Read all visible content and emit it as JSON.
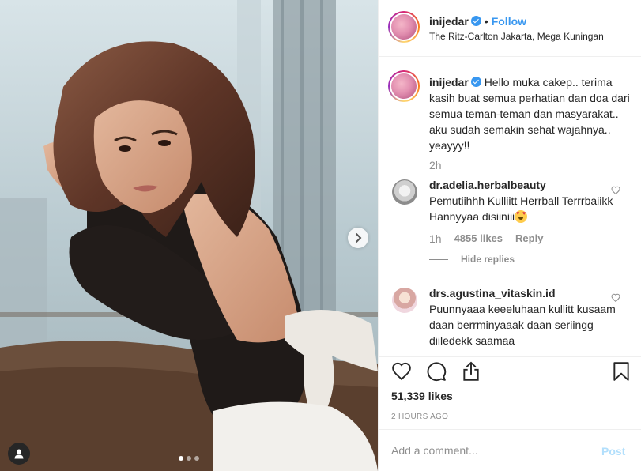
{
  "header": {
    "username": "inijedar",
    "separator": "•",
    "follow_label": "Follow",
    "location": "The Ritz-Carlton Jakarta, Mega Kuningan"
  },
  "caption": {
    "username": "inijedar",
    "text": "Hello muka cakep.. terima kasih buat semua perhatian dan doa dari semua teman-teman dan masyarakat.. aku sudah semakin sehat wajahnya.. yeayyy!!",
    "time": "2h"
  },
  "comments": [
    {
      "username": "dr.adelia.herbalbeauty",
      "text": "Pemutiihhh Kulliitt Herrball Terrrbaiikk Hannyyaa disiiniii",
      "age": "1h",
      "likes": "4855 likes",
      "reply_label": "Reply",
      "hide_replies_label": "Hide replies"
    },
    {
      "username": "drs.agustina_vitaskin.id",
      "text": "Puunnyaaa keeeluhaan kullitt kusaam daan berrminyaaak daan seriingg diiledekk saamaa"
    }
  ],
  "post": {
    "likes": "51,339 likes",
    "timestamp": "2 HOURS AGO"
  },
  "add_comment": {
    "placeholder": "Add a comment...",
    "post_label": "Post"
  },
  "carousel": {
    "current": 1,
    "total": 3
  },
  "colors": {
    "accent": "#3897f0",
    "text": "#262626",
    "muted": "#8e8e8e",
    "border": "#efefef",
    "post_disabled": "#b2dffc"
  },
  "icons": [
    "verified-badge-icon",
    "heart-icon",
    "comment-icon",
    "share-icon",
    "bookmark-icon",
    "chevron-right-icon",
    "user-tag-icon",
    "heart-eyes-emoji"
  ]
}
